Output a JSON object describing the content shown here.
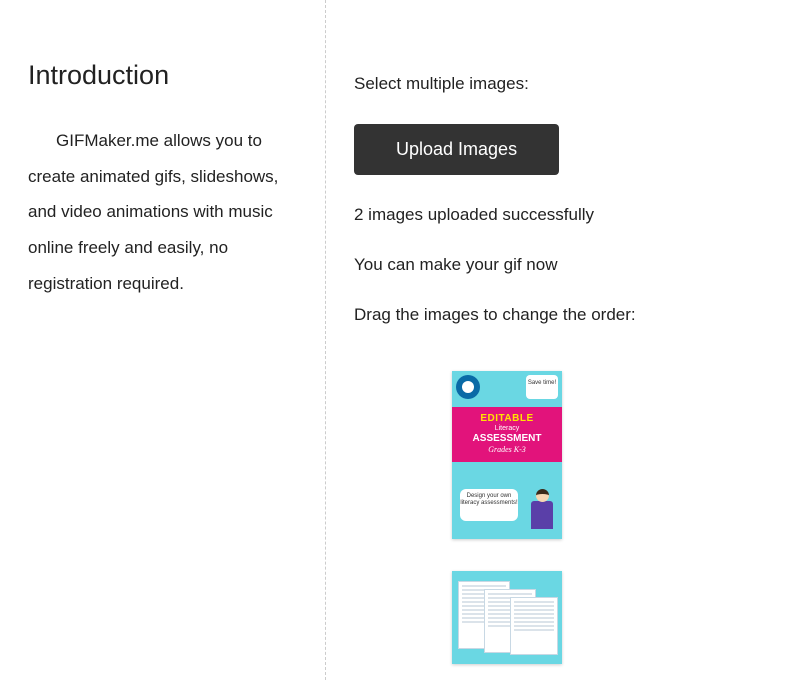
{
  "intro": {
    "heading": "Introduction",
    "body": "GIFMaker.me allows you to create animated gifs, slideshows, and video animations with music online freely and easily, no registration required."
  },
  "upload": {
    "select_label": "Select multiple images:",
    "button_label": "Upload Images",
    "status": "2 images uploaded successfully",
    "hint": "You can make your gif now",
    "drag_label": "Drag the images to change the order:"
  },
  "thumbs": {
    "thumb1": {
      "bubble_top": "Save time!",
      "editable": "EDITABLE",
      "literacy": "Literacy",
      "assessment": "ASSESSMENT",
      "grades": "Grades K-3",
      "bubble_bottom": "Design your own literacy assessments!"
    }
  }
}
